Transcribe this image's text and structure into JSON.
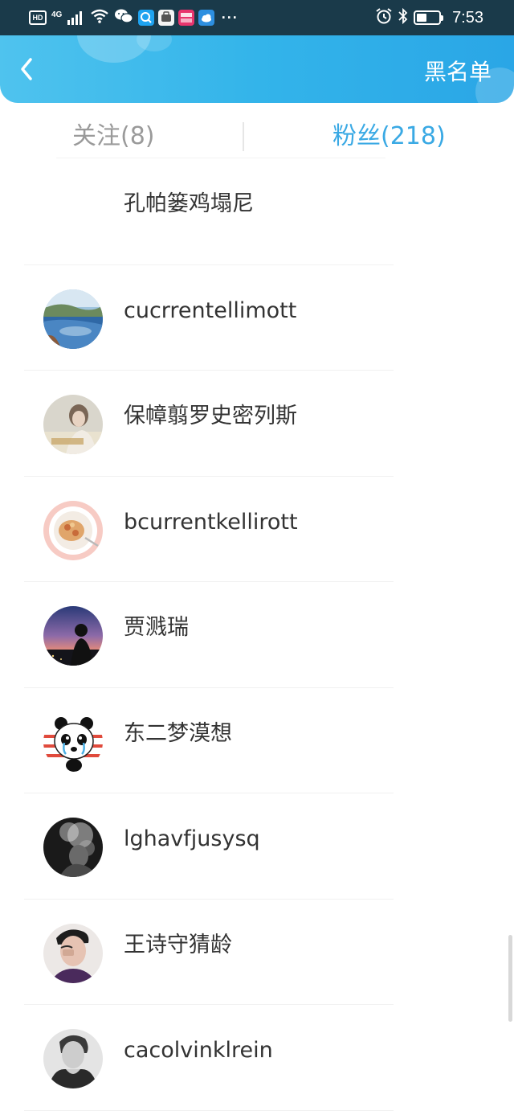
{
  "status_bar": {
    "left_icons": [
      "hd-icon",
      "signal-4g-icon",
      "wifi-icon",
      "wechat-icon",
      "search-app-icon",
      "huawei-app-icon",
      "shopping-app-icon",
      "cloud-app-icon"
    ],
    "hd_label": "HD",
    "network_label": "4G",
    "more_dots": "···",
    "right_icons": [
      "alarm-icon",
      "bluetooth-icon",
      "battery-icon"
    ],
    "time": "7:53"
  },
  "header": {
    "back_icon": "chevron-left-icon",
    "blacklist_label": "黑名单",
    "accent_color": "#33b4ea"
  },
  "tabs": {
    "following_label": "关注(8)",
    "fans_label": "粉丝(218)",
    "active": "fans",
    "active_color": "#3aa9e4",
    "inactive_color": "#9a9a9a"
  },
  "fans": [
    {
      "name": "孔帕篓鸡塌尼",
      "avatar": "none"
    },
    {
      "name": "cucrrentellimott",
      "avatar": "lake-landscape"
    },
    {
      "name": "保幛翦罗史密列斯",
      "avatar": "girl-photo"
    },
    {
      "name": "bcurrentkellirott",
      "avatar": "food-plate"
    },
    {
      "name": "贾溅瑞",
      "avatar": "sunset-silhouette"
    },
    {
      "name": "东二梦漠想",
      "avatar": "panda-cartoon"
    },
    {
      "name": "lghavfjusysq",
      "avatar": "smoke-bw"
    },
    {
      "name": "王诗守猜龄",
      "avatar": "boy-photo"
    },
    {
      "name": "cacolvinklrein",
      "avatar": "bw-portrait"
    }
  ]
}
